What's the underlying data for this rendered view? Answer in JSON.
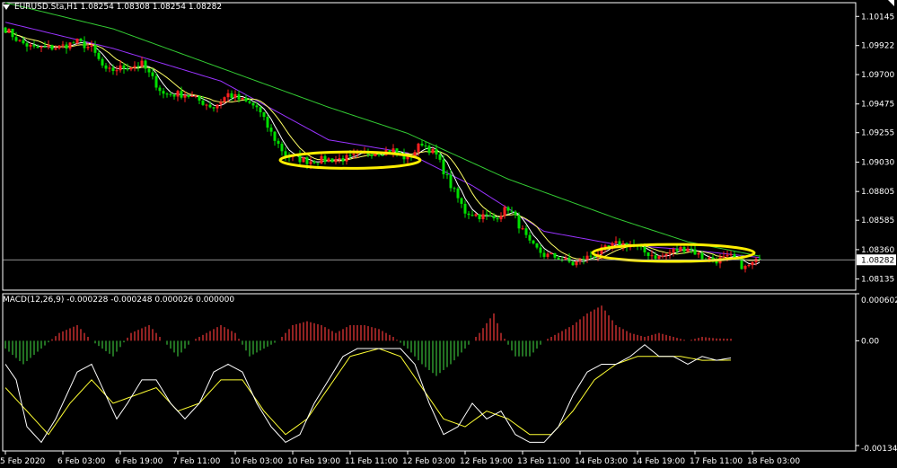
{
  "header": {
    "symbol_info": "EURUSD.Sta,H1  1.08254 1.08308 1.08254 1.08282",
    "current_price": "1.08282"
  },
  "indicator": {
    "label": "MACD(12,26,9) -0.000228 -0.000248 0.000026 0.000000"
  },
  "colors": {
    "background": "#000000",
    "axis": "#ffffff",
    "bull_candle": "#ff2020",
    "bear_candle": "#00e000",
    "ma_fast": "#ffffff",
    "ma_medium": "#ffff66",
    "ma_slow": "#9933ff",
    "ma_long": "#33cc33",
    "macd_line": "#ffffff",
    "signal_line": "#ffff33",
    "hist_positive": "#d03030",
    "hist_negative": "#30a030",
    "highlight_ellipse": "#ffee00",
    "price_line": "#c0c0c0"
  },
  "icons": [
    "dropdown-triangle-icon",
    "window-corner-icon"
  ],
  "chart_data": [
    {
      "type": "candlestick",
      "name": "EURUSD.Sta,H1",
      "ylim": [
        1.0805,
        1.1025
      ],
      "yticks": [
        "1.10145",
        "1.09922",
        "1.09700",
        "1.09475",
        "1.09255",
        "1.09030",
        "1.08805",
        "1.08585",
        "1.08360",
        "1.08135"
      ],
      "ytick_values": [
        1.10145,
        1.09922,
        1.097,
        1.09475,
        1.09255,
        1.0903,
        1.08805,
        1.08585,
        1.0836,
        1.08135
      ],
      "xticks": [
        "5 Feb 2020",
        "6 Feb 03:00",
        "6 Feb 19:00",
        "7 Feb 11:00",
        "10 Feb 03:00",
        "10 Feb 19:00",
        "11 Feb 11:00",
        "12 Feb 03:00",
        "12 Feb 19:00",
        "13 Feb 11:00",
        "14 Feb 03:00",
        "14 Feb 19:00",
        "17 Feb 11:00",
        "18 Feb 03:00"
      ],
      "xtick_index": [
        0,
        16,
        32,
        48,
        64,
        80,
        96,
        112,
        128,
        144,
        160,
        176,
        192,
        208
      ],
      "bars": 211,
      "last_close": 1.08282,
      "close_path": [
        [
          0,
          1.1005
        ],
        [
          4,
          1.0995
        ],
        [
          8,
          1.099
        ],
        [
          15,
          1.0991
        ],
        [
          20,
          1.0995
        ],
        [
          24,
          1.099
        ],
        [
          28,
          1.0972
        ],
        [
          32,
          1.0975
        ],
        [
          38,
          1.0978
        ],
        [
          44,
          1.0955
        ],
        [
          50,
          1.0955
        ],
        [
          54,
          1.095
        ],
        [
          58,
          1.0945
        ],
        [
          62,
          1.0955
        ],
        [
          66,
          1.095
        ],
        [
          70,
          1.0945
        ],
        [
          74,
          1.0925
        ],
        [
          78,
          1.0908
        ],
        [
          84,
          1.0904
        ],
        [
          90,
          1.0905
        ],
        [
          96,
          1.0906
        ],
        [
          100,
          1.091
        ],
        [
          108,
          1.0912
        ],
        [
          112,
          1.0905
        ],
        [
          116,
          1.0918
        ],
        [
          120,
          1.0908
        ],
        [
          124,
          1.0885
        ],
        [
          128,
          1.0865
        ],
        [
          132,
          1.0862
        ],
        [
          136,
          1.086
        ],
        [
          140,
          1.0868
        ],
        [
          142,
          1.086
        ],
        [
          146,
          1.084
        ],
        [
          150,
          1.0832
        ],
        [
          154,
          1.083
        ],
        [
          158,
          1.0825
        ],
        [
          162,
          1.083
        ],
        [
          166,
          1.0835
        ],
        [
          170,
          1.084
        ],
        [
          174,
          1.084
        ],
        [
          178,
          1.0834
        ],
        [
          182,
          1.083
        ],
        [
          186,
          1.0835
        ],
        [
          190,
          1.0838
        ],
        [
          194,
          1.083
        ],
        [
          198,
          1.0828
        ],
        [
          202,
          1.083
        ],
        [
          206,
          1.0822
        ],
        [
          210,
          1.08282
        ]
      ],
      "ma_long_path": [
        [
          0,
          1.1025
        ],
        [
          30,
          1.1005
        ],
        [
          60,
          1.0975
        ],
        [
          90,
          1.0945
        ],
        [
          112,
          1.0925
        ],
        [
          140,
          1.089
        ],
        [
          170,
          1.086
        ],
        [
          190,
          1.0842
        ],
        [
          210,
          1.0831
        ]
      ],
      "ma_slow_path": [
        [
          0,
          1.101
        ],
        [
          30,
          1.099
        ],
        [
          60,
          1.0965
        ],
        [
          90,
          1.092
        ],
        [
          112,
          1.091
        ],
        [
          130,
          1.0885
        ],
        [
          150,
          1.085
        ],
        [
          170,
          1.084
        ],
        [
          190,
          1.0836
        ],
        [
          210,
          1.083
        ]
      ],
      "highlight_ellipses": [
        {
          "center_bar": 96,
          "center_price": 1.09045,
          "bar_span": 39,
          "price_span": 0.00125
        },
        {
          "center_bar": 186,
          "center_price": 1.08335,
          "bar_span": 45,
          "price_span": 0.0013
        }
      ]
    },
    {
      "type": "macd",
      "name": "MACD(12,26,9)",
      "ylim": [
        -0.00141,
        0.000602
      ],
      "yticks": [
        "0.000602",
        "0.00",
        "-0.001341"
      ],
      "ytick_values": [
        0.000602,
        0.0,
        -0.001341
      ],
      "macd_path": [
        [
          0,
          -0.0003
        ],
        [
          3,
          -0.0005
        ],
        [
          6,
          -0.0011
        ],
        [
          10,
          -0.0013
        ],
        [
          14,
          -0.001
        ],
        [
          20,
          -0.0004
        ],
        [
          24,
          -0.0003
        ],
        [
          28,
          -0.0007
        ],
        [
          31,
          -0.001
        ],
        [
          34,
          -0.0008
        ],
        [
          38,
          -0.0005
        ],
        [
          42,
          -0.0005
        ],
        [
          46,
          -0.0008
        ],
        [
          50,
          -0.001
        ],
        [
          54,
          -0.0008
        ],
        [
          58,
          -0.0004
        ],
        [
          62,
          -0.0003
        ],
        [
          66,
          -0.0004
        ],
        [
          70,
          -0.0008
        ],
        [
          74,
          -0.0011
        ],
        [
          78,
          -0.0013
        ],
        [
          82,
          -0.0012
        ],
        [
          86,
          -0.0008
        ],
        [
          90,
          -0.0005
        ],
        [
          94,
          -0.0002
        ],
        [
          98,
          -0.0001
        ],
        [
          104,
          -0.0001
        ],
        [
          110,
          -0.0001
        ],
        [
          114,
          -0.0003
        ],
        [
          118,
          -0.0008
        ],
        [
          122,
          -0.0012
        ],
        [
          126,
          -0.0011
        ],
        [
          130,
          -0.0008
        ],
        [
          134,
          -0.001
        ],
        [
          138,
          -0.0009
        ],
        [
          142,
          -0.0012
        ],
        [
          146,
          -0.0013
        ],
        [
          150,
          -0.0013
        ],
        [
          154,
          -0.0011
        ],
        [
          158,
          -0.0007
        ],
        [
          162,
          -0.0004
        ],
        [
          166,
          -0.0003
        ],
        [
          170,
          -0.0003
        ],
        [
          174,
          -0.0002
        ],
        [
          178,
          -5e-05
        ],
        [
          182,
          -0.0002
        ],
        [
          186,
          -0.0002
        ],
        [
          190,
          -0.0003
        ],
        [
          194,
          -0.0002
        ],
        [
          198,
          -0.00025
        ],
        [
          202,
          -0.00022
        ]
      ],
      "signal_path": [
        [
          0,
          -0.0006
        ],
        [
          6,
          -0.0009
        ],
        [
          12,
          -0.0012
        ],
        [
          18,
          -0.0008
        ],
        [
          24,
          -0.0005
        ],
        [
          30,
          -0.0008
        ],
        [
          36,
          -0.0007
        ],
        [
          42,
          -0.0006
        ],
        [
          48,
          -0.0009
        ],
        [
          54,
          -0.0008
        ],
        [
          60,
          -0.0005
        ],
        [
          66,
          -0.0005
        ],
        [
          72,
          -0.0009
        ],
        [
          78,
          -0.0012
        ],
        [
          84,
          -0.001
        ],
        [
          90,
          -0.0006
        ],
        [
          96,
          -0.0002
        ],
        [
          104,
          -0.0001
        ],
        [
          110,
          -0.0002
        ],
        [
          116,
          -0.0006
        ],
        [
          122,
          -0.001
        ],
        [
          128,
          -0.0011
        ],
        [
          134,
          -0.0009
        ],
        [
          140,
          -0.001
        ],
        [
          146,
          -0.0012
        ],
        [
          152,
          -0.0012
        ],
        [
          158,
          -0.0009
        ],
        [
          164,
          -0.0005
        ],
        [
          170,
          -0.0003
        ],
        [
          176,
          -0.0002
        ],
        [
          182,
          -0.0002
        ],
        [
          188,
          -0.0002
        ],
        [
          194,
          -0.00025
        ],
        [
          202,
          -0.000248
        ]
      ],
      "histogram_path": [
        [
          0,
          -0.0001
        ],
        [
          5,
          -0.0003
        ],
        [
          10,
          -0.0001
        ],
        [
          15,
          0.0001
        ],
        [
          20,
          0.0002
        ],
        [
          24,
          0.0
        ],
        [
          30,
          -0.0002
        ],
        [
          35,
          0.0001
        ],
        [
          40,
          0.0002
        ],
        [
          44,
          0.0
        ],
        [
          48,
          -0.0002
        ],
        [
          52,
          0.0
        ],
        [
          56,
          0.0001
        ],
        [
          60,
          0.0002
        ],
        [
          64,
          0.0001
        ],
        [
          68,
          -0.0002
        ],
        [
          72,
          -0.0001
        ],
        [
          76,
          0.0
        ],
        [
          80,
          0.0002
        ],
        [
          84,
          0.00025
        ],
        [
          88,
          0.0002
        ],
        [
          92,
          0.0001
        ],
        [
          96,
          0.0002
        ],
        [
          100,
          0.0002
        ],
        [
          104,
          0.00015
        ],
        [
          108,
          5e-05
        ],
        [
          112,
          -0.0001
        ],
        [
          116,
          -0.0003
        ],
        [
          120,
          -0.00045
        ],
        [
          124,
          -0.0003
        ],
        [
          128,
          -0.0001
        ],
        [
          132,
          0.0001
        ],
        [
          136,
          0.00035
        ],
        [
          138,
          0.0001
        ],
        [
          142,
          -0.0002
        ],
        [
          146,
          -0.0002
        ],
        [
          150,
          0.0
        ],
        [
          154,
          0.0001
        ],
        [
          158,
          0.0002
        ],
        [
          162,
          0.00035
        ],
        [
          166,
          0.00045
        ],
        [
          170,
          0.0002
        ],
        [
          174,
          0.0001
        ],
        [
          178,
          5e-05
        ],
        [
          182,
          0.0001
        ],
        [
          186,
          5e-05
        ],
        [
          190,
          0.0
        ],
        [
          194,
          5e-05
        ],
        [
          198,
          3e-05
        ],
        [
          202,
          2.6e-05
        ]
      ]
    }
  ]
}
